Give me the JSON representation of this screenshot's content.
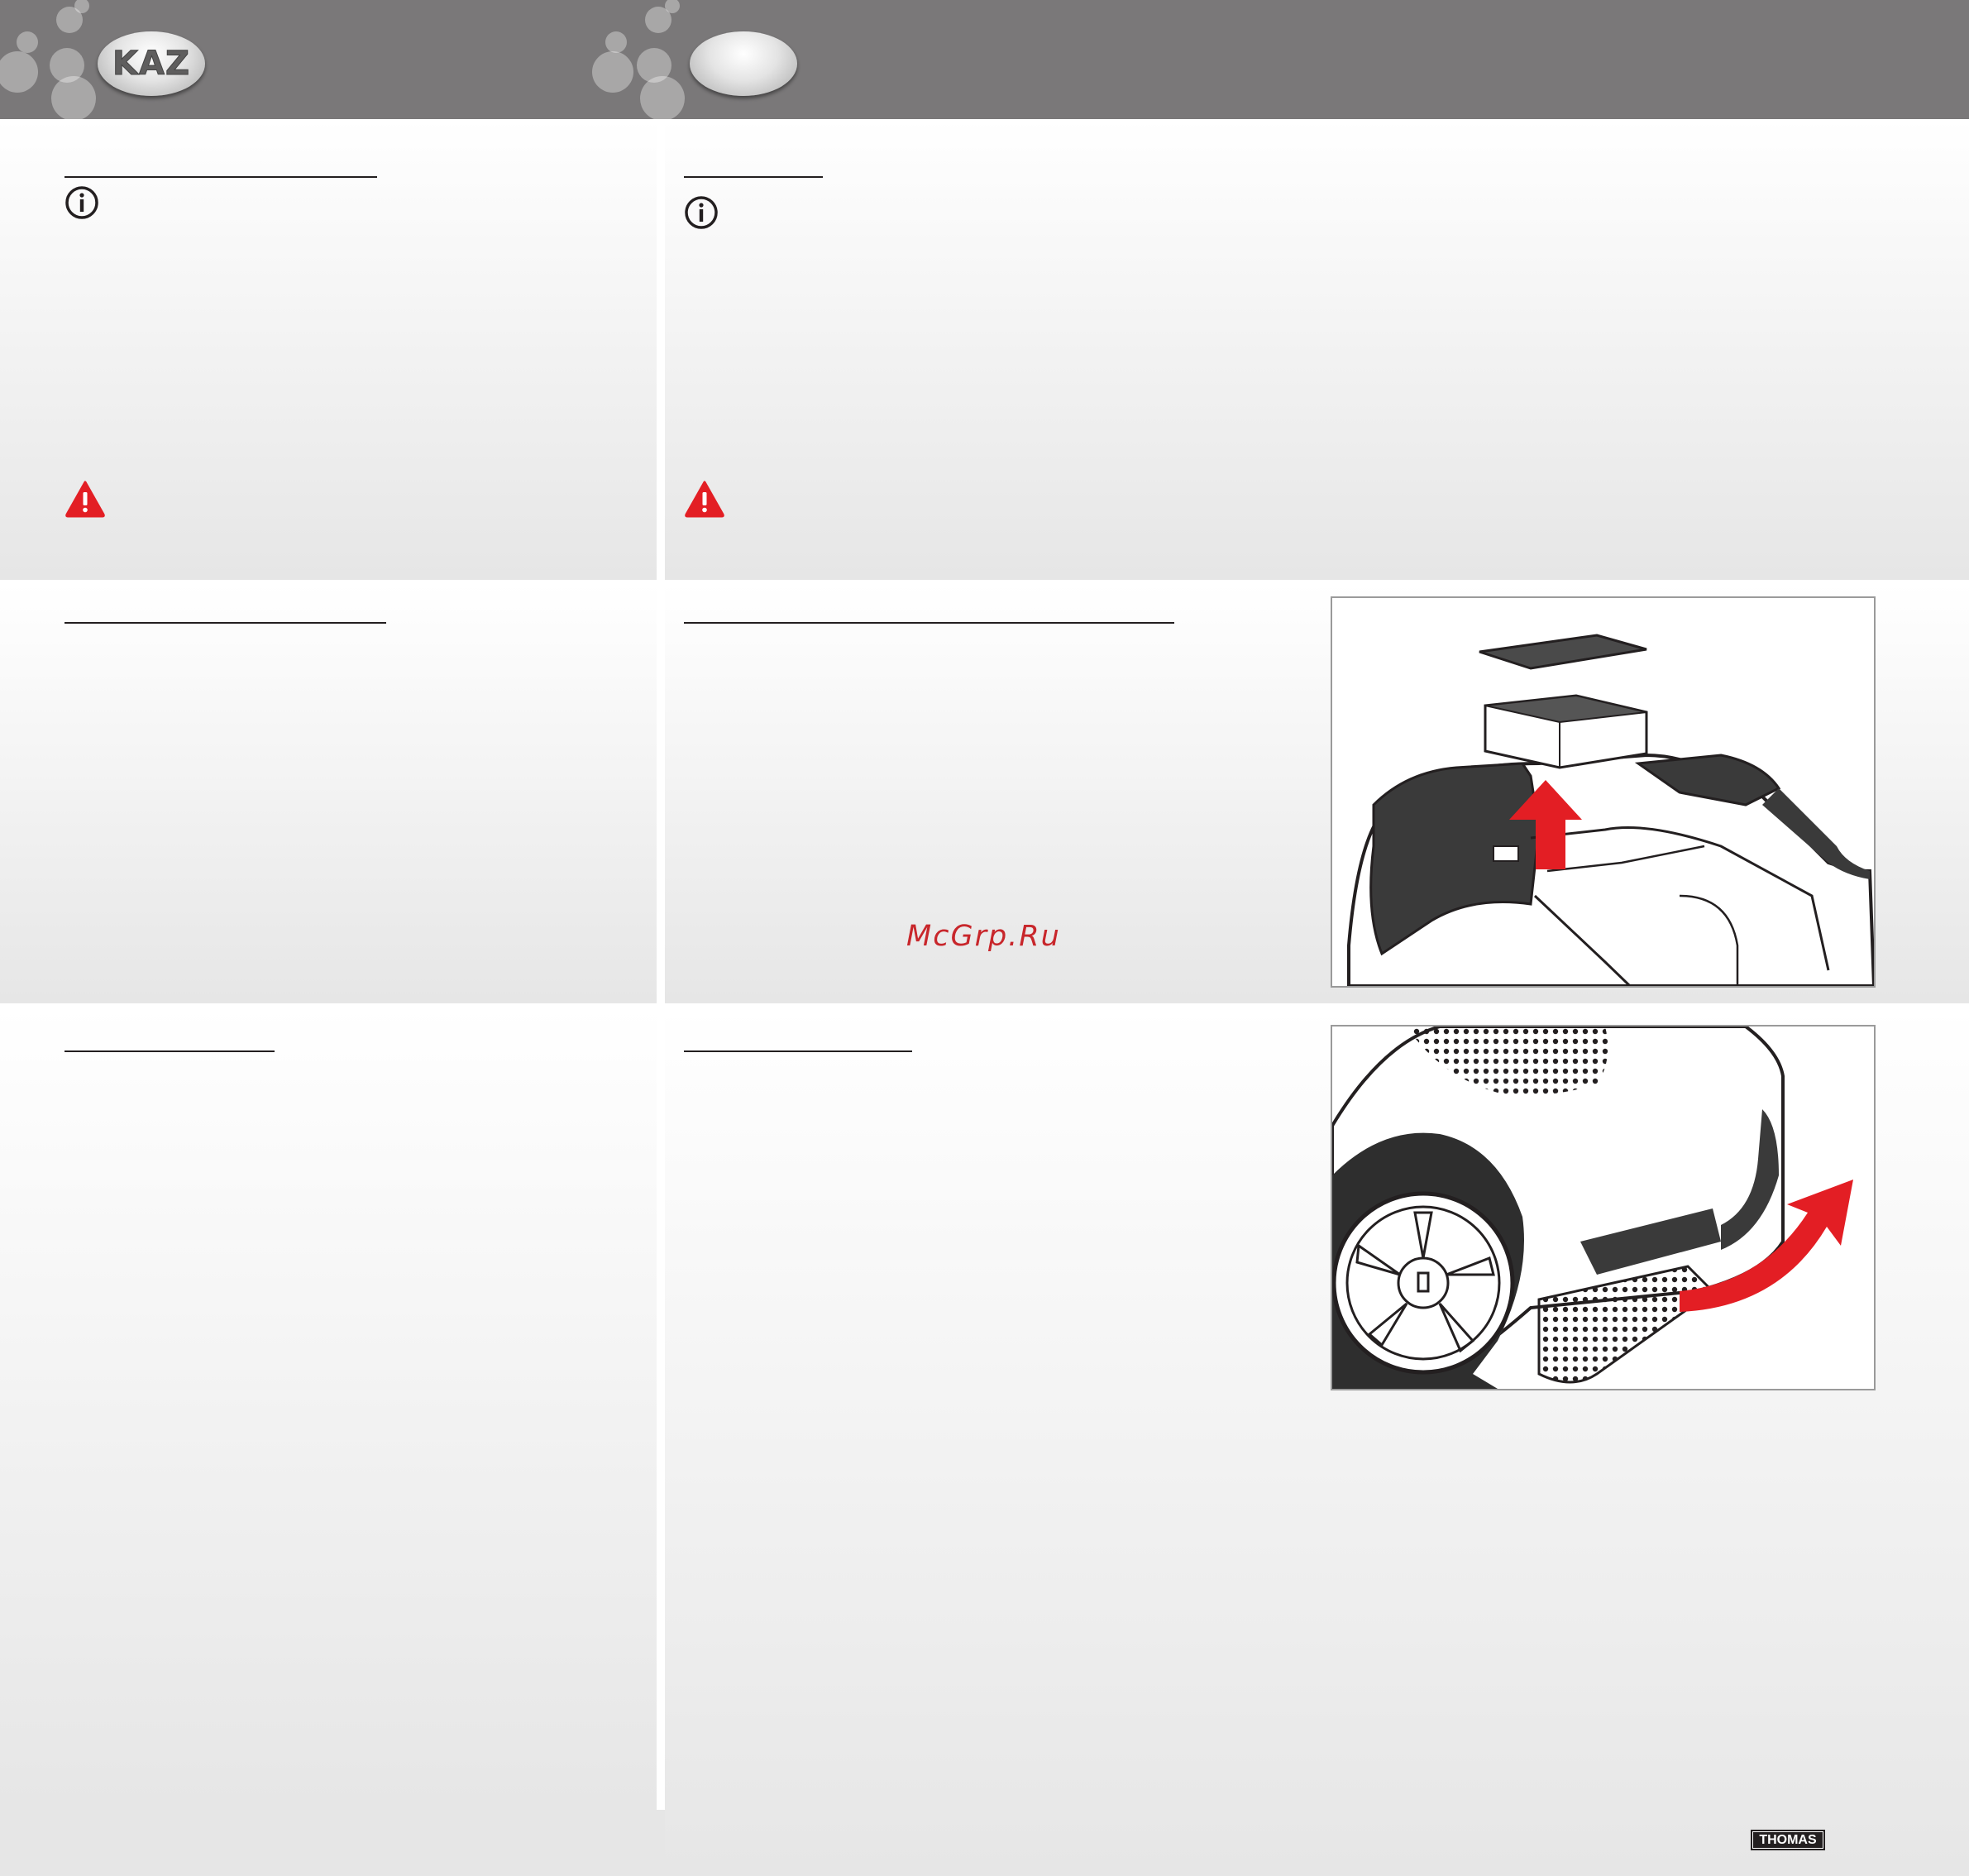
{
  "header": {
    "left_logo_text": "KAZ",
    "right_logo_text": ""
  },
  "watermark": "McGrp.Ru",
  "footer": {
    "brand": "THOMAS"
  },
  "colors": {
    "header_bg": "#7a7879",
    "warning_red": "#e31e24",
    "arrow_red": "#e31e24",
    "rule": "#231f20",
    "divider": "#ffffff"
  },
  "icons": [
    "info-icon",
    "warning-icon",
    "arrow-up-icon",
    "arrow-curved-icon"
  ]
}
